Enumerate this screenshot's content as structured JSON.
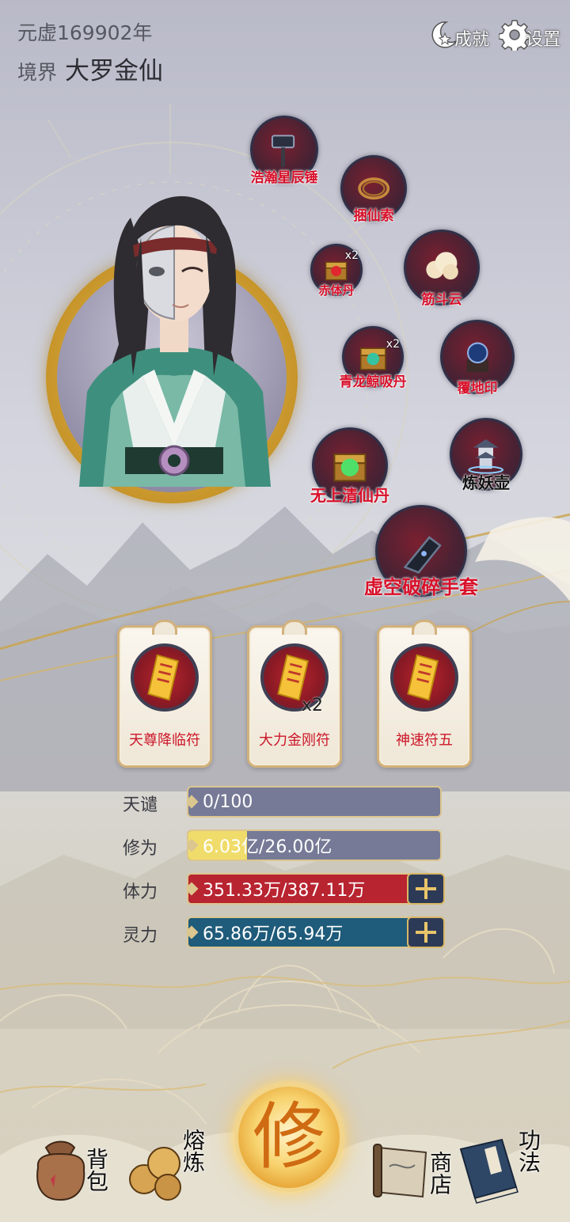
{
  "header": {
    "era": "元虚169902年",
    "realm_label": "境界",
    "realm_name": "大罗金仙",
    "achievements_label": "成就",
    "settings_label": "设置"
  },
  "equipment": [
    {
      "name": "浩瀚星辰锤",
      "icon": "hammer-icon"
    },
    {
      "name": "捆仙索",
      "icon": "rope-icon"
    },
    {
      "name": "赤体丹",
      "icon": "red-pill-chest-icon",
      "count": "x2"
    },
    {
      "name": "筋斗云",
      "icon": "cloud-icon"
    },
    {
      "name": "青龙鲸吸丹",
      "icon": "green-pill-chest-icon",
      "count": "x2"
    },
    {
      "name": "覆地印",
      "icon": "seal-icon"
    },
    {
      "name": "无上清仙丹",
      "icon": "green-orb-chest-icon"
    },
    {
      "name": "炼妖壶",
      "icon": "pagoda-icon"
    },
    {
      "name": "虚空破碎手套",
      "icon": "gauntlet-icon"
    }
  ],
  "talismans": [
    {
      "name": "天尊降临符",
      "count": ""
    },
    {
      "name": "大力金刚符",
      "count": "x2"
    },
    {
      "name": "神速符五",
      "count": ""
    }
  ],
  "stats": {
    "tianqian": {
      "label": "天谴",
      "text": "0/100",
      "fraction": 0.0
    },
    "xiuwei": {
      "label": "修为",
      "value": "6.03",
      "text_rest": "亿/26.00亿",
      "fraction": 0.232
    },
    "tili": {
      "label": "体力",
      "text": "351.33万/387.11万",
      "fraction": 0.908
    },
    "lingli": {
      "label": "灵力",
      "text": "65.86万/65.94万",
      "fraction": 0.999
    }
  },
  "nav": {
    "bag": "背包",
    "smelt": "熔炼",
    "cultivate": "修",
    "shop": "商店",
    "skills": "功法"
  },
  "colors": {
    "tianqian_bar": "#767a96",
    "xiuwei_bar": "#767a96",
    "xiuwei_fill": "#f0dc6a",
    "tili_bar": "#b82430",
    "lingli_bar": "#1f5b7a",
    "item_name": "#d8102a",
    "accent_gold": "#d9b766"
  }
}
